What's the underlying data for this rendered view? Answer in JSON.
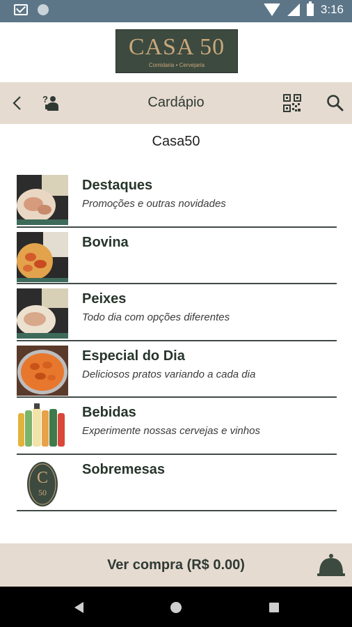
{
  "status_bar": {
    "time": "3:16",
    "icons": [
      "gmail-icon",
      "circle-icon",
      "wifi-icon",
      "signal-icon",
      "battery-icon"
    ]
  },
  "logo": {
    "title": "CASA 50",
    "subtitle": "Comidaria • Cervejaria"
  },
  "toolbar": {
    "title": "Cardápio",
    "icons": [
      "back-arrow-icon",
      "call-waiter-icon",
      "qr-code-icon",
      "search-icon"
    ]
  },
  "restaurant_name": "Casa50",
  "menu": [
    {
      "title": "Destaques",
      "description": "Promoções e outras novidades"
    },
    {
      "title": "Bovina",
      "description": ""
    },
    {
      "title": "Peixes",
      "description": "Todo dia com opções diferentes"
    },
    {
      "title": "Especial do Dia",
      "description": "Deliciosos pratos variando a cada dia"
    },
    {
      "title": "Bebidas",
      "description": "Experimente nossas cervejas e vinhos"
    },
    {
      "title": "Sobremesas",
      "description": ""
    }
  ],
  "cart": {
    "label": "Ver compra (R$ 0.00)"
  },
  "colors": {
    "accent_bg": "#e6dbd1",
    "brand_green": "#3c4a3f",
    "brand_gold": "#c9a77a",
    "status_bar": "#5c7688"
  }
}
